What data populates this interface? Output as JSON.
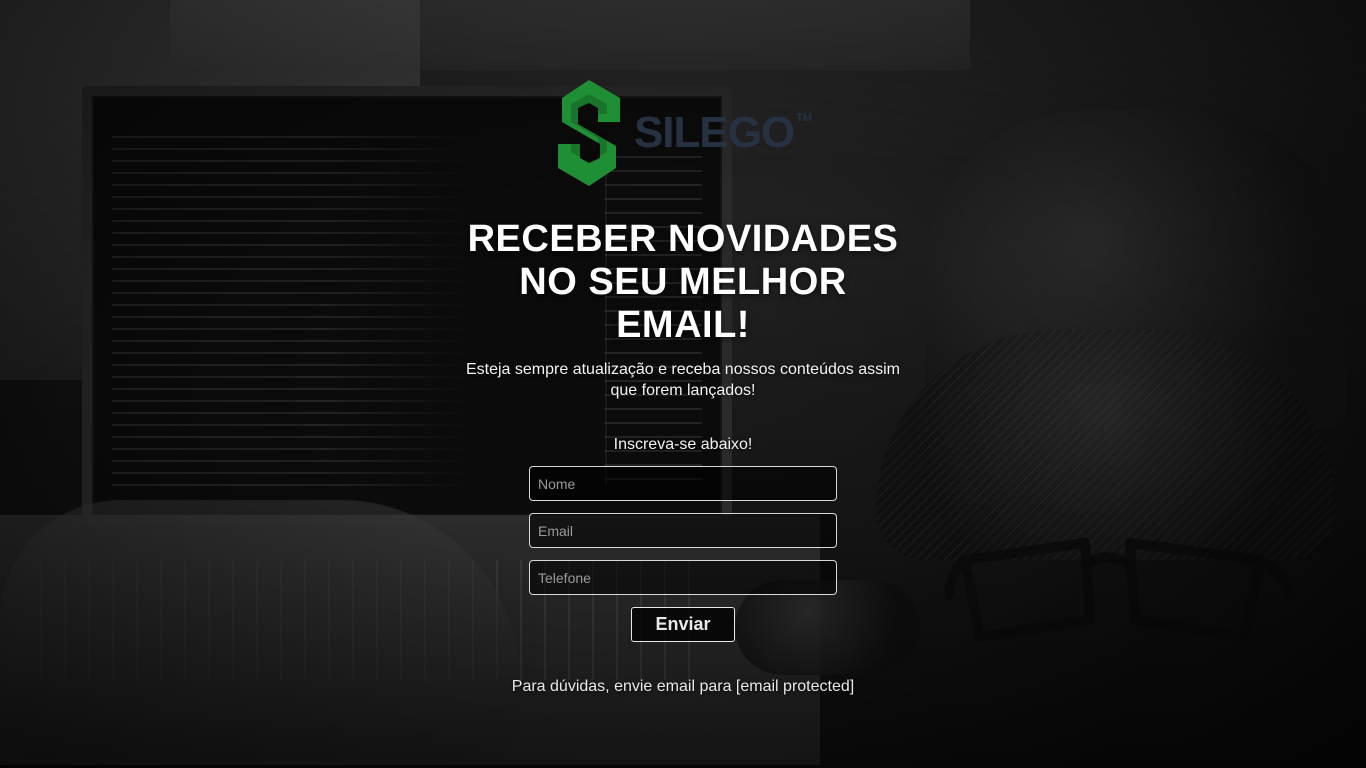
{
  "brand": {
    "name": "SILEGO",
    "trademark": "TM",
    "colors": {
      "primary_green": "#1f8f36",
      "text_navy": "#263242"
    }
  },
  "hero": {
    "headline": "RECEBER NOVIDADES\nNO SEU MELHOR\nEMAIL!",
    "subheadline": "Esteja sempre atualização e receba nossos conteúdos assim que forem lançados!",
    "cta_label": "Inscreva-se abaixo!"
  },
  "form": {
    "name_placeholder": "Nome",
    "email_placeholder": "Email",
    "phone_placeholder": "Telefone",
    "submit_label": "Enviar"
  },
  "footer": {
    "note_prefix": "Para dúvidas, envie email para",
    "email_text": "[email protected]"
  }
}
